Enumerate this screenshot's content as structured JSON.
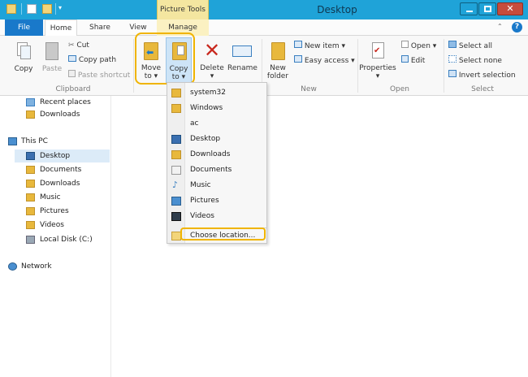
{
  "window": {
    "title": "Desktop",
    "context_tab": "Picture Tools",
    "close_glyph": "✕"
  },
  "tabs": {
    "file": "File",
    "home": "Home",
    "share": "Share",
    "view": "View",
    "manage": "Manage"
  },
  "ribbon": {
    "clipboard": {
      "label": "Clipboard",
      "copy": "Copy",
      "paste": "Paste",
      "cut": "Cut",
      "copy_path": "Copy path",
      "paste_shortcut": "Paste shortcut"
    },
    "organize": {
      "move_to_1": "Move",
      "move_to_2": "to ▾",
      "copy_to_1": "Copy",
      "copy_to_2": "to ▾",
      "delete_1": "Delete",
      "delete_2": "▾",
      "rename": "Rename"
    },
    "new": {
      "label": "New",
      "new_folder_1": "New",
      "new_folder_2": "folder",
      "new_item": "New item ▾",
      "easy_access": "Easy access ▾"
    },
    "open": {
      "label": "Open",
      "properties_1": "Properties",
      "properties_2": "▾",
      "open": "Open ▾",
      "edit": "Edit"
    },
    "select": {
      "label": "Select",
      "select_all": "Select all",
      "select_none": "Select none",
      "invert_selection": "Invert selection"
    }
  },
  "nav": {
    "recent_places": "Recent places",
    "downloads_fav": "Downloads",
    "this_pc": "This PC",
    "desktop": "Desktop",
    "documents": "Documents",
    "downloads": "Downloads",
    "music": "Music",
    "pictures": "Pictures",
    "videos": "Videos",
    "local_disk": "Local Disk (C:)",
    "network": "Network"
  },
  "copy_to_menu": {
    "items": [
      "system32",
      "Windows",
      "ac",
      "Desktop",
      "Downloads",
      "Documents",
      "Music",
      "Pictures",
      "Videos"
    ],
    "choose_location": "Choose location..."
  },
  "colors": {
    "titlebar": "#1fa3d8",
    "file_tab": "#1979ca",
    "highlight": "#f0b400",
    "folder": "#e8b83c"
  }
}
